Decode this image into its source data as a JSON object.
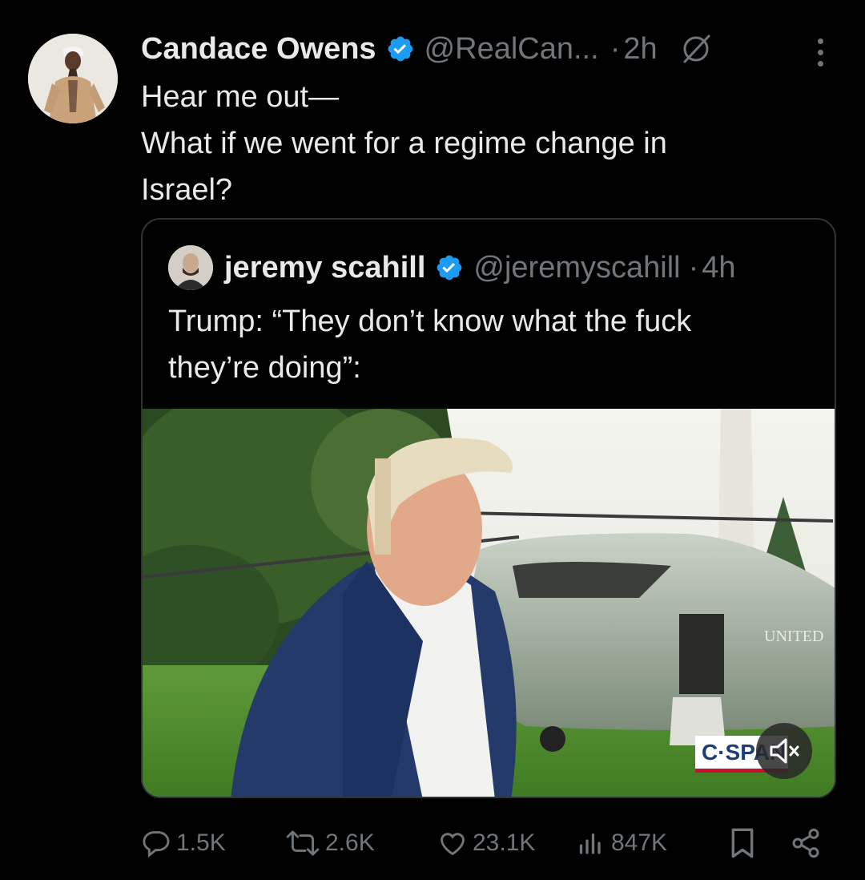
{
  "tweet": {
    "author_name": "Candace Owens",
    "handle": "@RealCan...",
    "separator": "·",
    "time": "2h",
    "text_lines": [
      "Hear me out—",
      "What if we went for a regime change in",
      "Israel?"
    ]
  },
  "quote": {
    "author_name": "jeremy scahill",
    "handle": "@jeremyscahill",
    "separator": "·",
    "time": "4h",
    "text_lines": [
      "Trump: “They don’t know what the fuck",
      "they’re doing”:"
    ],
    "media": {
      "watermark": "C·SPAN",
      "sign_text": "UNITED"
    }
  },
  "actions": {
    "replies": "1.5K",
    "reposts": "2.6K",
    "likes": "23.1K",
    "views": "847K"
  },
  "colors": {
    "background": "#000000",
    "primary_text": "#e7e9ea",
    "secondary_text": "#71767b",
    "verified_blue": "#1d9bf0",
    "border": "#2f3336"
  },
  "icons": [
    "verified-badge-icon",
    "grok-icon",
    "more-icon",
    "reply-icon",
    "repost-icon",
    "like-icon",
    "views-icon",
    "bookmark-icon",
    "share-icon",
    "mute-icon"
  ]
}
